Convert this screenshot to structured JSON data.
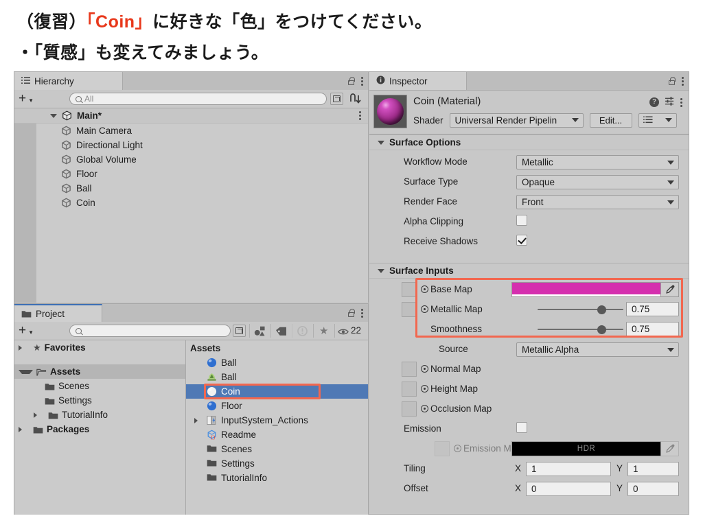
{
  "slide": {
    "line1_prefix": "（復習）",
    "line1_accent": "「Coin」",
    "line1_suffix": "に好きな「色」をつけてください。",
    "line2": "・「質感」も変えてみましょう。",
    "accent_color": "#e8381b"
  },
  "hierarchy": {
    "tab_label": "Hierarchy",
    "add_label": "+",
    "search_placeholder": "All",
    "root": {
      "label": "Main*"
    },
    "items": [
      {
        "label": "Main Camera"
      },
      {
        "label": "Directional Light"
      },
      {
        "label": "Global Volume"
      },
      {
        "label": "Floor"
      },
      {
        "label": "Ball"
      },
      {
        "label": "Coin"
      }
    ]
  },
  "project": {
    "tab_label": "Project",
    "add_label": "+",
    "search_placeholder": "",
    "visible_count": "22",
    "tree": [
      {
        "label": "Favorites",
        "icon": "star-icon",
        "bold": true,
        "indent": 0,
        "arrow": "closed",
        "selected": false
      },
      {
        "label": "Assets",
        "icon": "folder-open-icon",
        "bold": true,
        "indent": 0,
        "arrow": "open",
        "selected": true
      },
      {
        "label": "Scenes",
        "icon": "folder-icon",
        "bold": false,
        "indent": 1,
        "arrow": "none",
        "selected": false
      },
      {
        "label": "Settings",
        "icon": "folder-icon",
        "bold": false,
        "indent": 1,
        "arrow": "none",
        "selected": false
      },
      {
        "label": "TutorialInfo",
        "icon": "folder-icon",
        "bold": false,
        "indent": 1,
        "arrow": "closed",
        "selected": false
      },
      {
        "label": "Packages",
        "icon": "folder-icon",
        "bold": true,
        "indent": 0,
        "arrow": "closed",
        "selected": false
      }
    ],
    "assets_header": "Assets",
    "assets": [
      {
        "label": "Ball",
        "icon": "material-ball-icon",
        "color": "#2f6fd0",
        "arrow": "none",
        "selected": false
      },
      {
        "label": "Ball",
        "icon": "prefab-icon",
        "color": "#7ab648",
        "arrow": "none",
        "selected": false
      },
      {
        "label": "Coin",
        "icon": "material-ball-icon",
        "color": "#f2f2f2",
        "arrow": "none",
        "selected": true
      },
      {
        "label": "Floor",
        "icon": "material-ball-icon",
        "color": "#2f6fd0",
        "arrow": "none",
        "selected": false
      },
      {
        "label": "InputSystem_Actions",
        "icon": "input-actions-icon",
        "color": "#dcdcdc",
        "arrow": "closed",
        "selected": false
      },
      {
        "label": "Readme",
        "icon": "script-object-icon",
        "color": "#4a8fe0",
        "arrow": "none",
        "selected": false
      },
      {
        "label": "Scenes",
        "icon": "folder-icon",
        "color": "#5a5a5a",
        "arrow": "none",
        "selected": false
      },
      {
        "label": "Settings",
        "icon": "folder-icon",
        "color": "#5a5a5a",
        "arrow": "none",
        "selected": false
      },
      {
        "label": "TutorialInfo",
        "icon": "folder-icon",
        "color": "#5a5a5a",
        "arrow": "none",
        "selected": false
      }
    ]
  },
  "inspector": {
    "tab_label": "Inspector",
    "material_name": "Coin (Material)",
    "shader_label": "Shader",
    "shader_value": "Universal Render Pipelin",
    "edit_button": "Edit...",
    "surface_options": {
      "title": "Surface Options",
      "rows": [
        {
          "label": "Workflow Mode",
          "type": "dropdown",
          "value": "Metallic"
        },
        {
          "label": "Surface Type",
          "type": "dropdown",
          "value": "Opaque"
        },
        {
          "label": "Render Face",
          "type": "dropdown",
          "value": "Front"
        },
        {
          "label": "Alpha Clipping",
          "type": "checkbox",
          "value": false
        },
        {
          "label": "Receive Shadows",
          "type": "checkbox",
          "value": true
        }
      ]
    },
    "surface_inputs": {
      "title": "Surface Inputs",
      "base_map": {
        "label": "Base Map",
        "color": "#d52fae"
      },
      "metallic_map": {
        "label": "Metallic Map",
        "value": "0.75",
        "slider_pct": 75
      },
      "smoothness": {
        "label": "Smoothness",
        "value": "0.75",
        "slider_pct": 75
      },
      "source": {
        "label": "Source",
        "value": "Metallic Alpha"
      },
      "normal_map": {
        "label": "Normal Map"
      },
      "height_map": {
        "label": "Height Map"
      },
      "occlusion_map": {
        "label": "Occlusion Map"
      },
      "emission": {
        "label": "Emission",
        "value": false
      },
      "emission_map": {
        "label": "Emission M",
        "badge": "HDR",
        "color": "#000000"
      },
      "tiling": {
        "label": "Tiling",
        "x_label": "X",
        "x": "1",
        "y_label": "Y",
        "y": "1"
      },
      "offset": {
        "label": "Offset",
        "x_label": "X",
        "x": "0",
        "y_label": "Y",
        "y": "0"
      }
    }
  },
  "highlight": {
    "color": "#f2674f"
  }
}
